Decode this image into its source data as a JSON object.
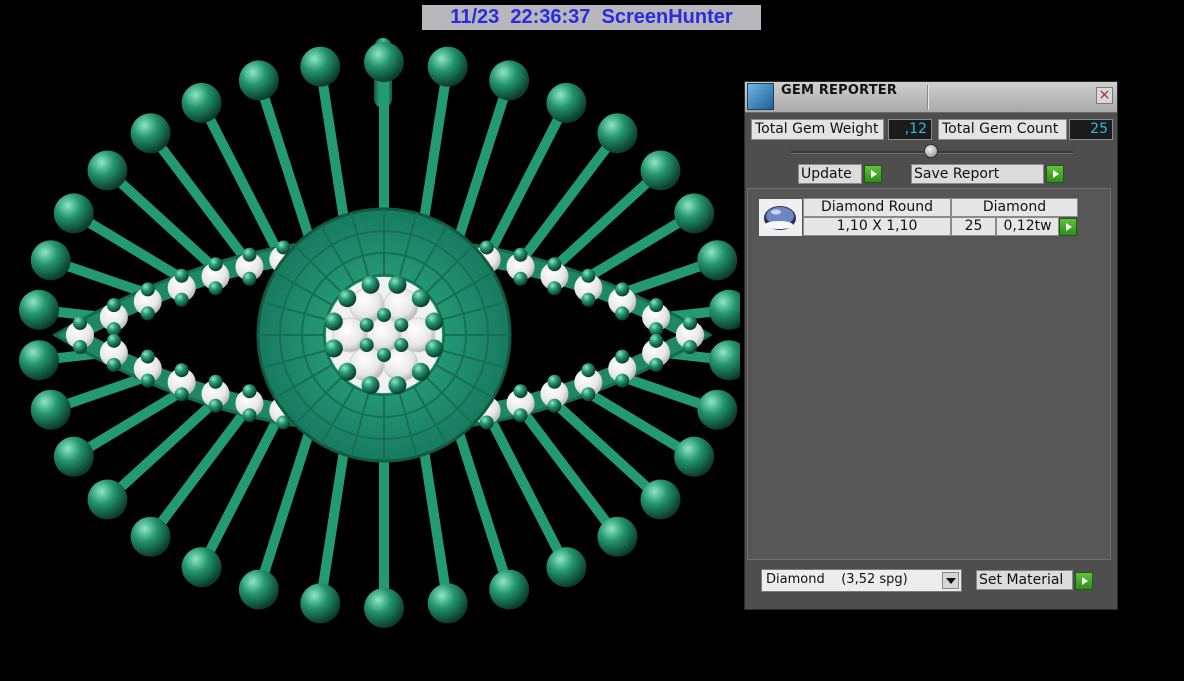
{
  "watermark": {
    "text": "11/23  22:36:37  ScreenHunter"
  },
  "viewport": {
    "model_color": "#1f8a67",
    "stone_color": "#f4f4f4",
    "background": "#000000"
  },
  "panel": {
    "title": "GEM REPORTER",
    "close_icon": "×",
    "total_weight_label": "Total Gem Weight",
    "total_weight_value": ",12",
    "total_count_label": "Total Gem Count",
    "total_count_value": "25",
    "update_label": "Update",
    "save_report_label": "Save Report",
    "gems": [
      {
        "cut": "Diamond Round",
        "material": "Diamond",
        "size": "1,10 X 1,10",
        "count": "25",
        "weight": "0,12tw"
      }
    ],
    "material_select_value": "Diamond    (3,52 spg)",
    "set_material_label": "Set Material"
  }
}
